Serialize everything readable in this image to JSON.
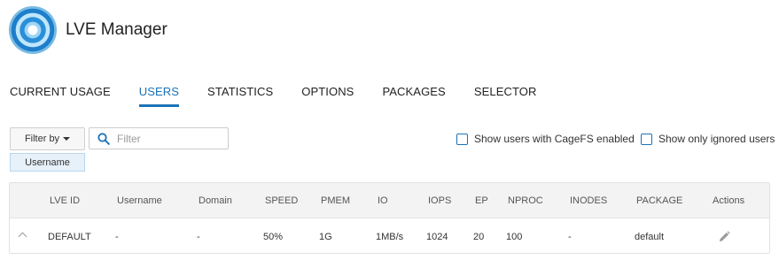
{
  "app": {
    "title": "LVE Manager"
  },
  "tabs": [
    {
      "label": "CURRENT USAGE",
      "active": false
    },
    {
      "label": "USERS",
      "active": true
    },
    {
      "label": "STATISTICS",
      "active": false
    },
    {
      "label": "OPTIONS",
      "active": false
    },
    {
      "label": "PACKAGES",
      "active": false
    },
    {
      "label": "SELECTOR",
      "active": false
    }
  ],
  "filter": {
    "button_label": "Filter by",
    "search_placeholder": "Filter",
    "active_chip": "Username"
  },
  "checkboxes": {
    "cagefs_label": "Show users with CageFS enabled",
    "cagefs_checked": false,
    "ignored_label": "Show only ignored users",
    "ignored_checked": false
  },
  "table": {
    "headers": [
      "LVE ID",
      "Username",
      "Domain",
      "SPEED",
      "PMEM",
      "IO",
      "IOPS",
      "EP",
      "NPROC",
      "INODES",
      "PACKAGE",
      "Actions"
    ],
    "rows": [
      [
        "DEFAULT",
        "-",
        "-",
        "50%",
        "1G",
        "1MB/s",
        "1024",
        "20",
        "100",
        "-",
        "default"
      ]
    ]
  },
  "colors": {
    "accent": "#1a73b8",
    "header_bg": "#f3f3f3",
    "chip_bg": "#e6f1fa"
  },
  "icons": {
    "logo": "swirl-logo-icon",
    "search": "search-icon",
    "edit": "pencil-icon",
    "expand": "chevron-up-icon"
  }
}
